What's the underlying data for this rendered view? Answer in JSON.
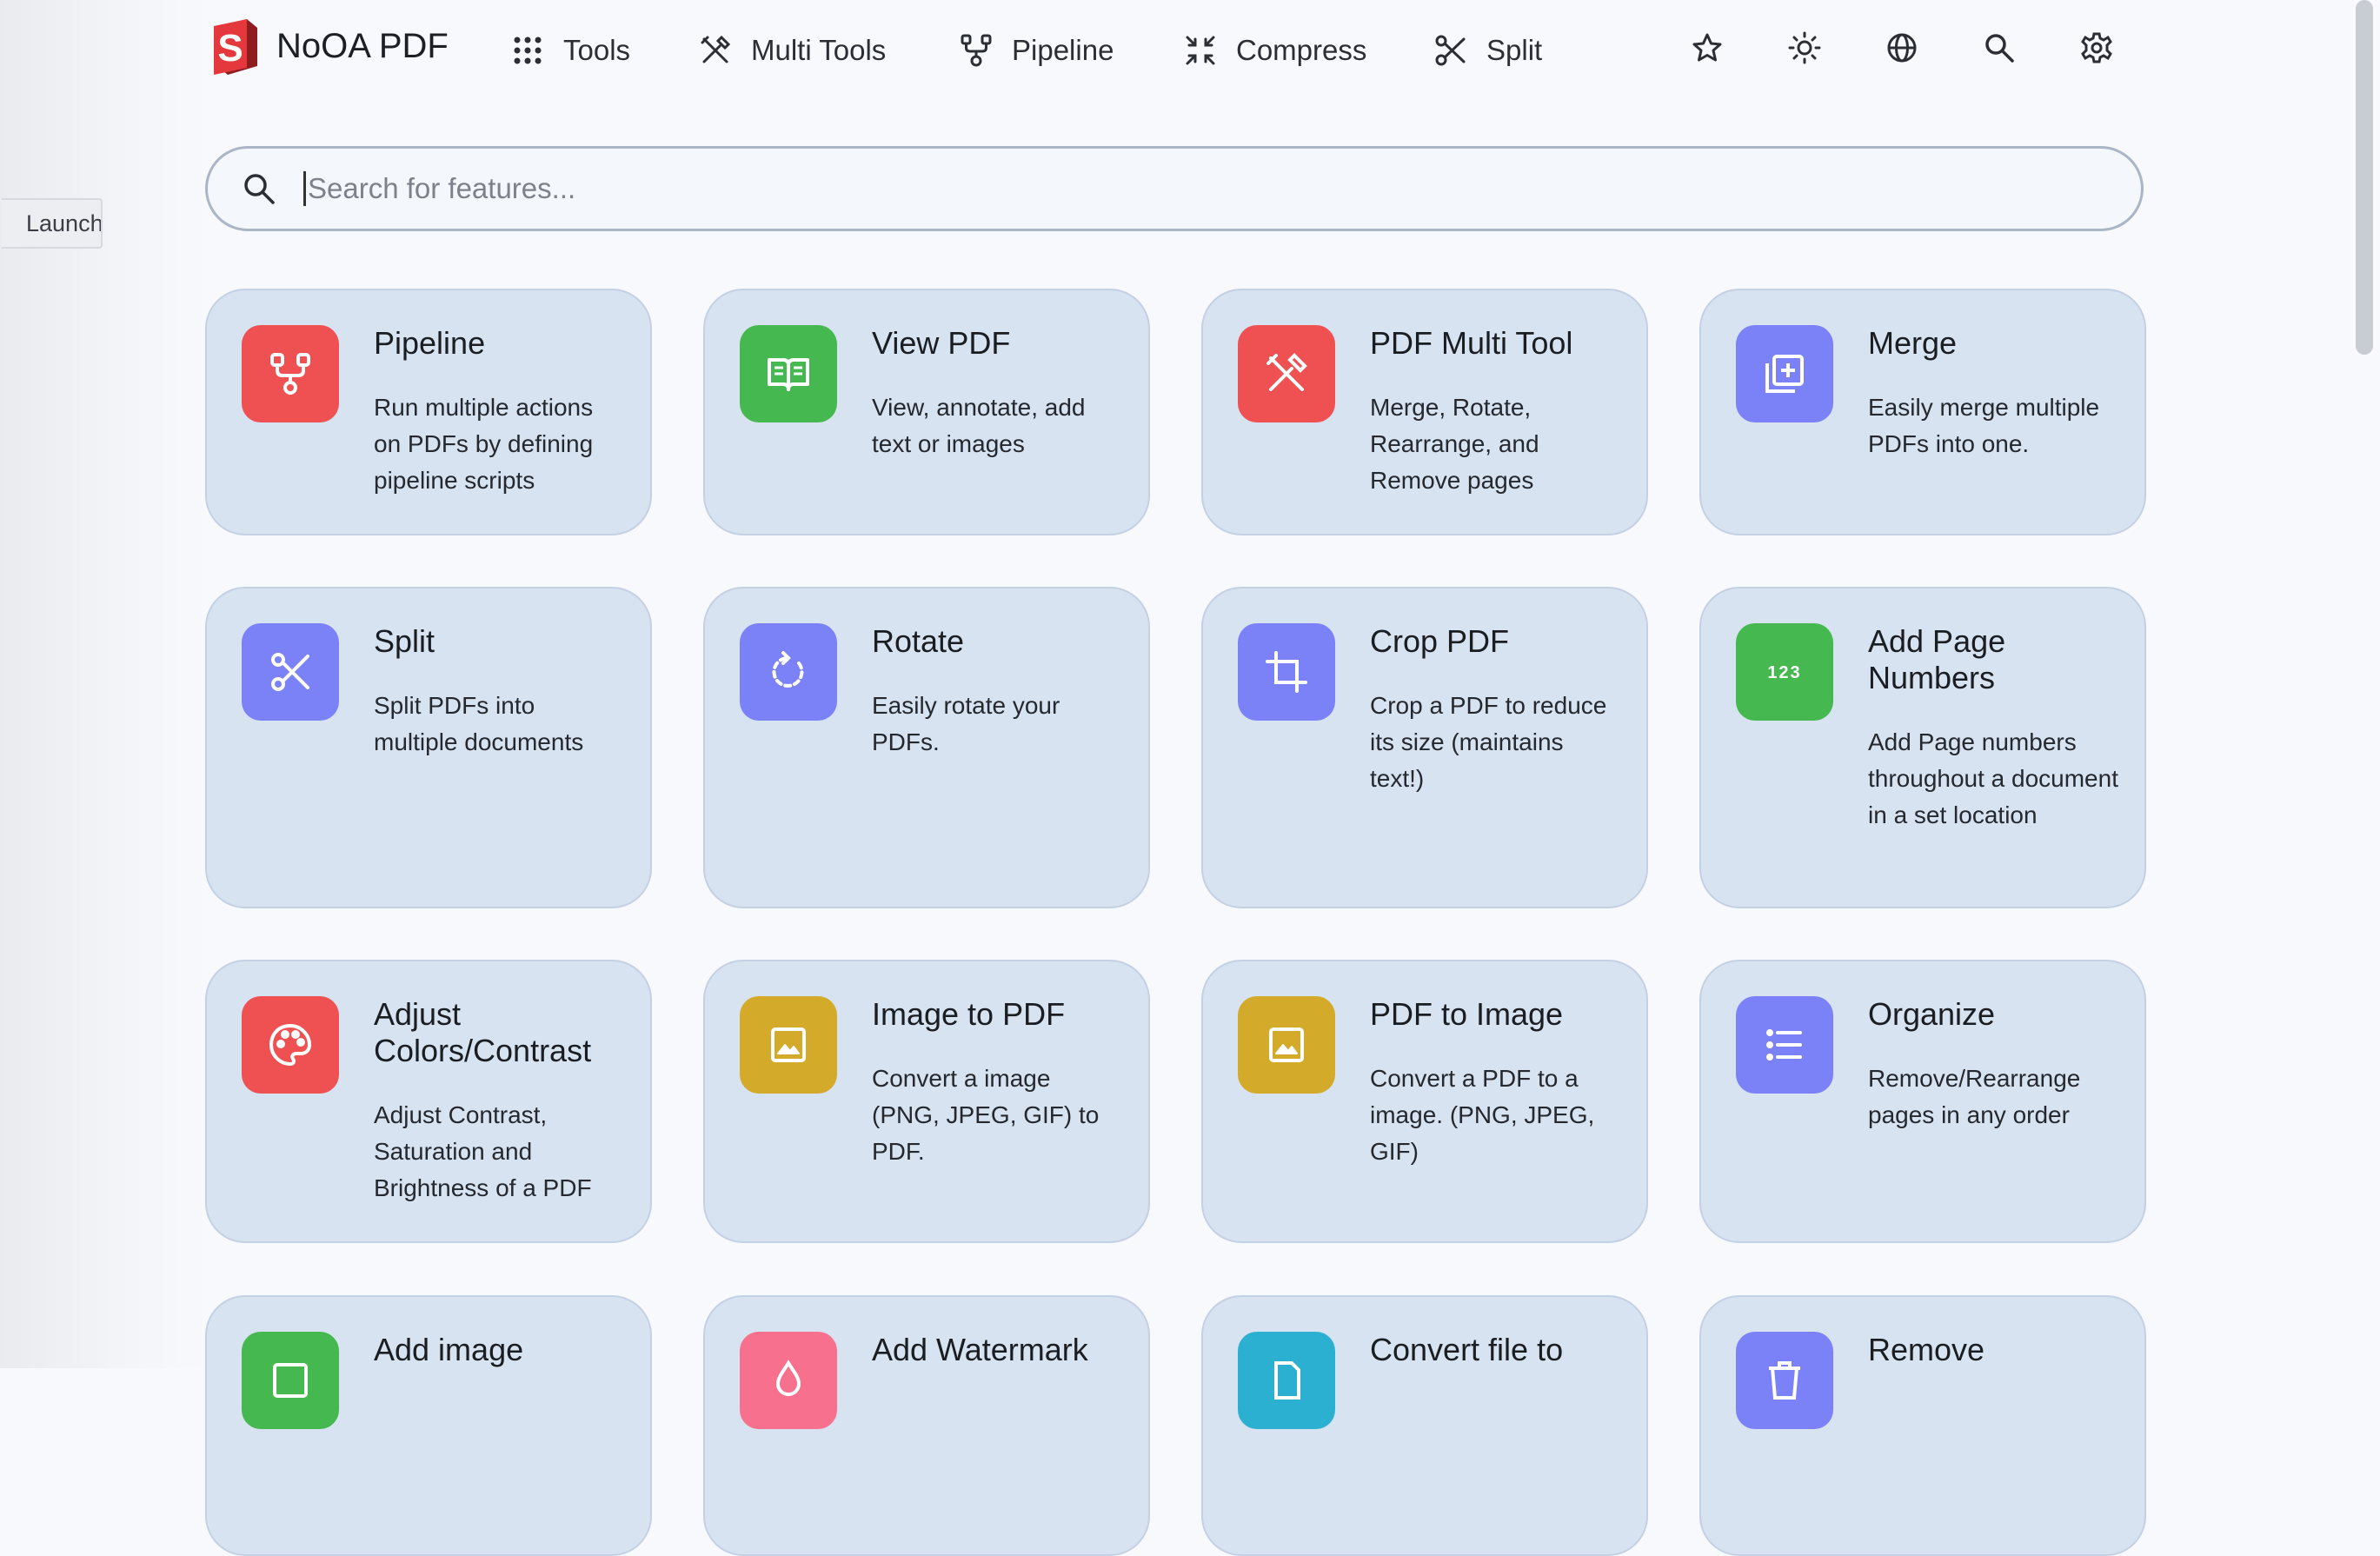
{
  "brand": {
    "name": "NoOA PDF"
  },
  "nav": {
    "tools": "Tools",
    "multi_tools": "Multi Tools",
    "pipeline": "Pipeline",
    "compress": "Compress",
    "split": "Split"
  },
  "side_tab": {
    "label": "Launch"
  },
  "search": {
    "placeholder": "Search for features..."
  },
  "cards": [
    {
      "title": "Pipeline",
      "desc": "Run multiple actions on PDFs by defining pipeline scripts",
      "icon": "pipeline-icon"
    },
    {
      "title": "View PDF",
      "desc": "View, annotate, add text or images",
      "icon": "book-icon"
    },
    {
      "title": "PDF Multi Tool",
      "desc": "Merge, Rotate, Rearrange, and Remove pages",
      "icon": "tools-icon"
    },
    {
      "title": "Merge",
      "desc": "Easily merge multiple PDFs into one.",
      "icon": "add-to-stack-icon"
    },
    {
      "title": "Split",
      "desc": "Split PDFs into multiple documents",
      "icon": "scissors-icon"
    },
    {
      "title": "Rotate",
      "desc": "Easily rotate your PDFs.",
      "icon": "rotate-icon"
    },
    {
      "title": "Crop PDF",
      "desc": "Crop a PDF to reduce its size (maintains text!)",
      "icon": "crop-icon"
    },
    {
      "title": "Add Page Numbers",
      "desc": "Add Page numbers throughout a document in a set location",
      "icon": "numbers-123-icon"
    },
    {
      "title": "Adjust Colors/Contrast",
      "desc": "Adjust Contrast, Saturation and Brightness of a PDF",
      "icon": "palette-icon"
    },
    {
      "title": "Image to PDF",
      "desc": "Convert a image (PNG, JPEG, GIF) to PDF.",
      "icon": "image-icon"
    },
    {
      "title": "PDF to Image",
      "desc": "Convert a PDF to a image. (PNG, JPEG, GIF)",
      "icon": "image-icon"
    },
    {
      "title": "Organize",
      "desc": "Remove/Rearrange pages in any order",
      "icon": "list-icon"
    },
    {
      "title": "Add image",
      "desc": "",
      "icon": "add-image-icon"
    },
    {
      "title": "Add Watermark",
      "desc": "",
      "icon": "watermark-icon"
    },
    {
      "title": "Convert file to",
      "desc": "",
      "icon": "convert-file-icon"
    },
    {
      "title": "Remove",
      "desc": "",
      "icon": "trash-icon"
    }
  ],
  "colors": {
    "red": "#ef5052",
    "green": "#45b84f",
    "indigo": "#7b81f7",
    "yellow": "#d4aa2b",
    "pink": "#f7708e",
    "cyan": "#2bb0d2",
    "card_bg": "#d8e3f1",
    "page_bg": "#f7f9fd"
  }
}
